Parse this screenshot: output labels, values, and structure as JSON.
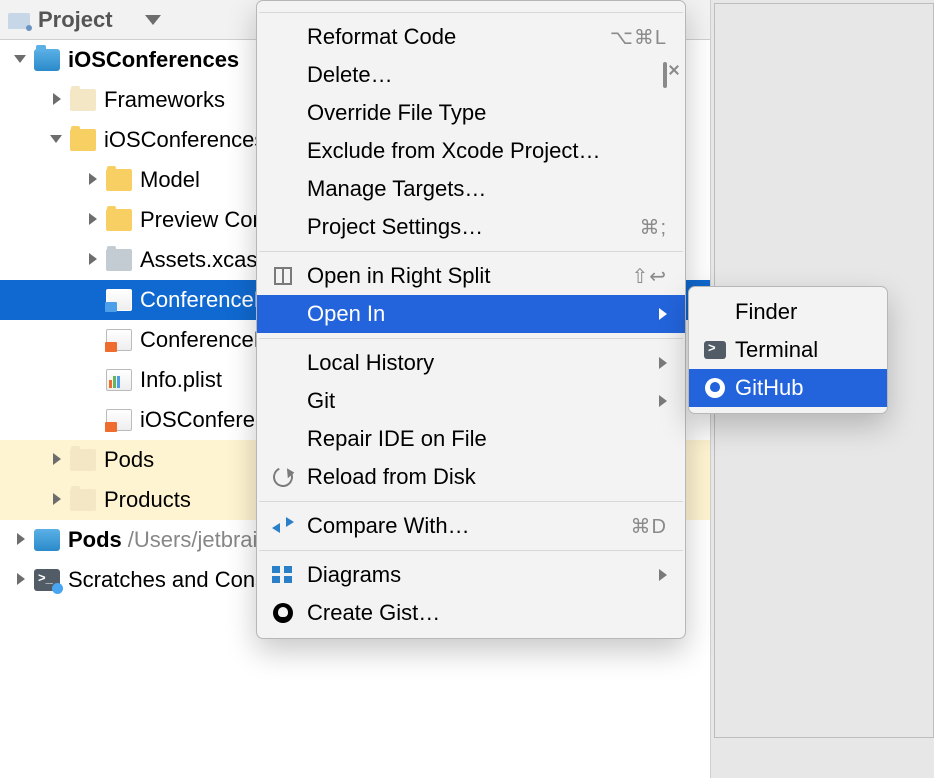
{
  "panel": {
    "title": "Project"
  },
  "tree": [
    {
      "depth": 0,
      "arrow": "exp",
      "icon": "ic-proj",
      "label": "iOSConferences",
      "bold": true
    },
    {
      "depth": 1,
      "arrow": "col",
      "icon": "ic-fold-beige",
      "label": "Frameworks"
    },
    {
      "depth": 1,
      "arrow": "exp",
      "icon": "ic-fold-yellow",
      "label": "iOSConferences"
    },
    {
      "depth": 2,
      "arrow": "col",
      "icon": "ic-fold-yellow",
      "label": "Model"
    },
    {
      "depth": 2,
      "arrow": "col",
      "icon": "ic-fold-yellow",
      "label": "Preview Content"
    },
    {
      "depth": 2,
      "arrow": "col",
      "icon": "ic-fold-gray",
      "label": "Assets.xcassets"
    },
    {
      "depth": 2,
      "arrow": "",
      "icon": "ic-file-swift blue",
      "label": "ConferenceDetails.swift",
      "sel": true
    },
    {
      "depth": 2,
      "arrow": "",
      "icon": "ic-file-swift",
      "label": "ConferenceList.swift"
    },
    {
      "depth": 2,
      "arrow": "",
      "icon": "ic-file-plist",
      "label": "Info.plist"
    },
    {
      "depth": 2,
      "arrow": "",
      "icon": "ic-file-swift",
      "label": "iOSConferencesApp.swift"
    },
    {
      "depth": 1,
      "arrow": "col",
      "icon": "ic-fold-beige",
      "label": "Pods",
      "hl": true
    },
    {
      "depth": 1,
      "arrow": "col",
      "icon": "ic-fold-beige",
      "label": "Products",
      "hl": true
    },
    {
      "depth": 0,
      "arrow": "col",
      "icon": "ic-pods",
      "label": "Pods",
      "bold": true,
      "path": "/Users/jetbrains/..."
    },
    {
      "depth": 0,
      "arrow": "col",
      "icon": "ic-scratch",
      "label": "Scratches and Consoles"
    }
  ],
  "menu": [
    {
      "type": "sep"
    },
    {
      "label": "Reformat Code",
      "shortcut": "⌥⌘L"
    },
    {
      "label": "Delete…",
      "right_icon": "mi-del"
    },
    {
      "label": "Override File Type"
    },
    {
      "label": "Exclude from Xcode Project…"
    },
    {
      "label": "Manage Targets…"
    },
    {
      "label": "Project Settings…",
      "shortcut": "⌘;"
    },
    {
      "type": "sep"
    },
    {
      "label": "Open in Right Split",
      "icon": "mi-split",
      "shortcut": "⇧↩"
    },
    {
      "label": "Open In",
      "sel": true,
      "submenu": true
    },
    {
      "type": "sep"
    },
    {
      "label": "Local History",
      "submenu": true
    },
    {
      "label": "Git",
      "submenu": true
    },
    {
      "label": "Repair IDE on File"
    },
    {
      "label": "Reload from Disk",
      "icon": "mi-reload"
    },
    {
      "type": "sep"
    },
    {
      "label": "Compare With…",
      "icon": "mi-compare",
      "shortcut": "⌘D"
    },
    {
      "type": "sep"
    },
    {
      "label": "Diagrams",
      "icon": "mi-diagram",
      "submenu": true
    },
    {
      "label": "Create Gist…",
      "icon": "mi-gist"
    }
  ],
  "submenu": [
    {
      "label": "Finder"
    },
    {
      "label": "Terminal",
      "icon": "si-term"
    },
    {
      "label": "GitHub",
      "icon": "si-gh white",
      "sel": true
    }
  ]
}
